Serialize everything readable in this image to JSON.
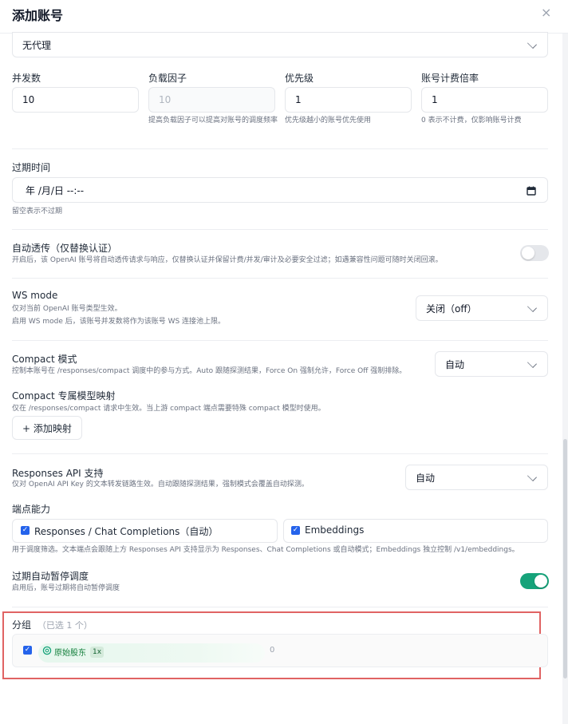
{
  "dialog": {
    "title": "添加账号",
    "close_glyph": "×"
  },
  "proxy": {
    "value": "无代理"
  },
  "fields": {
    "concurrency": {
      "label": "并发数",
      "value": "10"
    },
    "load_factor": {
      "label": "负载因子",
      "placeholder": "10",
      "hint": "提高负载因子可以提高对账号的调度频率"
    },
    "priority": {
      "label": "优先级",
      "value": "1",
      "hint": "优先级越小的账号优先使用"
    },
    "billing_rate": {
      "label": "账号计费倍率",
      "value": "1",
      "hint": "0 表示不计费，仅影响账号计费"
    }
  },
  "expiry": {
    "label": "过期时间",
    "value": "年 /月/日 --:--",
    "hint": "留空表示不过期"
  },
  "passthrough": {
    "label": "自动透传（仅替换认证）",
    "hint": "开启后，该 OpenAI 账号将自动透传请求与响应，仅替换认证并保留计费/并发/审计及必要安全过滤；如遇兼容性问题可随时关闭回滚。",
    "enabled": false
  },
  "ws_mode": {
    "label": "WS mode",
    "hint1": "仅对当前 OpenAI 账号类型生效。",
    "hint2": "启用 WS mode 后，该账号并发数将作为该账号 WS 连接池上限。",
    "value": "关闭（off）"
  },
  "compact": {
    "label": "Compact 模式",
    "hint": "控制本账号在 /responses/compact 调度中的参与方式。Auto 跟随探测结果，Force On 强制允许，Force Off 强制排除。",
    "value": "自动",
    "mapping_label": "Compact 专属模型映射",
    "mapping_hint": "仅在 /responses/compact 请求中生效。当上游 compact 端点需要特殊 compact 模型时使用。",
    "add_mapping": "+ 添加映射"
  },
  "responses_api": {
    "label": "Responses API 支持",
    "hint": "仅对 OpenAI API Key 的文本转发链路生效。自动跟随探测结果，强制模式会覆盖自动探测。",
    "value": "自动"
  },
  "endpoints": {
    "label": "端点能力",
    "options": [
      {
        "label": "Responses / Chat Completions（自动）",
        "checked": true
      },
      {
        "label": "Embeddings",
        "checked": true
      }
    ],
    "hint": "用于调度筛选。文本端点会跟随上方 Responses API 支持显示为 Responses、Chat Completions 或自动模式；Embeddings 独立控制 /v1/embeddings。"
  },
  "auto_pause": {
    "label": "过期自动暂停调度",
    "hint": "启用后，账号过期将自动暂停调度",
    "enabled": true
  },
  "groups": {
    "label": "分组",
    "selected_note": "（已选 1 个）",
    "items": [
      {
        "name": "原始股东",
        "multiplier": "1x",
        "count": "0",
        "checked": true
      }
    ]
  },
  "colors": {
    "accent": "#16a37a",
    "checkbox": "#2563eb",
    "highlight": "#e06363"
  }
}
